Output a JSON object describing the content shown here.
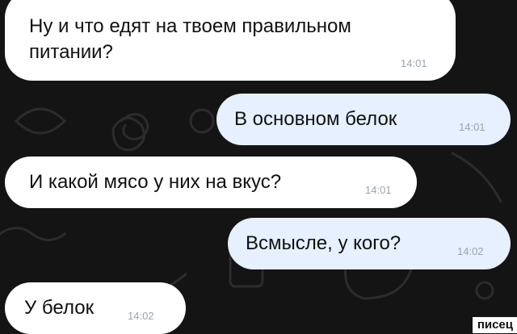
{
  "chat": {
    "messages": [
      {
        "direction": "incoming",
        "text_lines": [
          "Ну и что едят на твоем правильном",
          "питании?"
        ],
        "time": "14:01"
      },
      {
        "direction": "outgoing",
        "text": "В основном белок",
        "time": "14:01"
      },
      {
        "direction": "incoming",
        "text": "И какой мясо у них на вкус?",
        "time": "14:01"
      },
      {
        "direction": "outgoing",
        "text": "Всмысле, у кого?",
        "time": "14:02"
      },
      {
        "direction": "incoming",
        "text": "У белок",
        "time": "14:02"
      }
    ]
  },
  "watermark": "писец",
  "colors": {
    "background": "#141414",
    "incoming_bubble": "#ffffff",
    "outgoing_bubble": "#e6f0ff",
    "time_text": "#9aa4b0",
    "doodle_stroke": "#2c2c2c"
  }
}
